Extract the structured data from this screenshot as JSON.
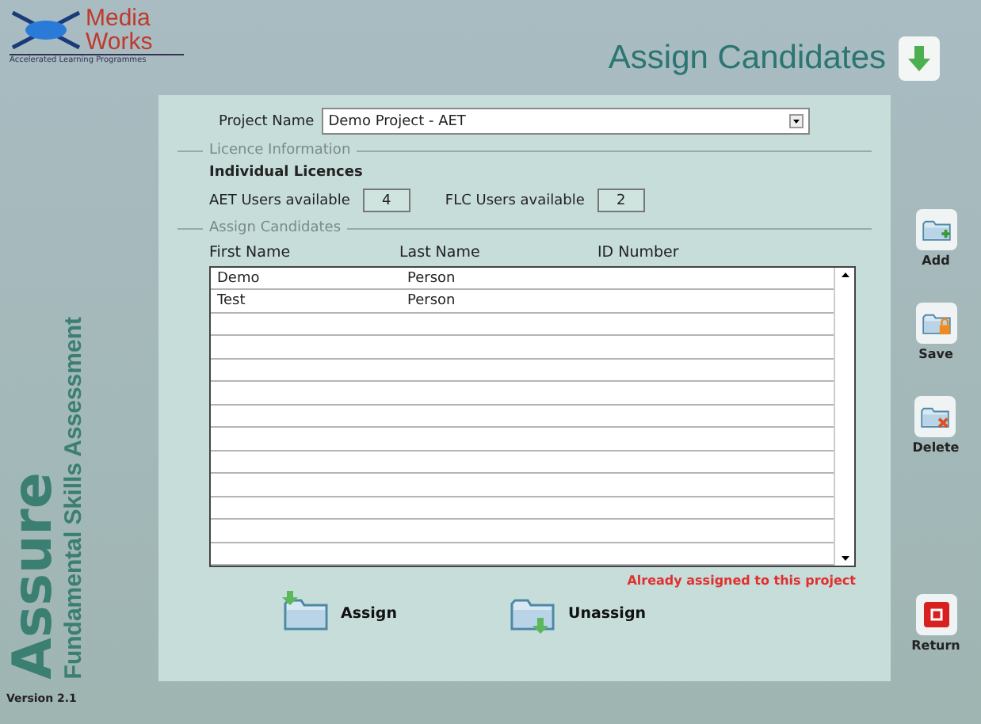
{
  "logo": {
    "line_1": "Media",
    "line_2": "Works",
    "tagline": "Accelerated Learning Programmes"
  },
  "title": "Assign Candidates",
  "sidebar": {
    "brand": "Assure",
    "subtitle": "Fundamental Skills Assessment",
    "version": "Version 2.1"
  },
  "project": {
    "label": "Project Name",
    "value": "Demo Project - AET"
  },
  "licence": {
    "legend": "Licence Information",
    "heading": "Individual Licences",
    "counters": [
      {
        "label": "AET Users available",
        "value": "4"
      },
      {
        "label": "FLC Users available",
        "value": "2"
      }
    ]
  },
  "candidates": {
    "legend": "Assign Candidates",
    "columns": [
      "First Name",
      "Last Name",
      "ID Number"
    ],
    "rows": [
      [
        "Demo",
        "Person"
      ],
      [
        "Test",
        "Person"
      ]
    ],
    "note": "Already assigned to this project"
  },
  "actions": [
    {
      "label": "Assign",
      "kind": "assign"
    },
    {
      "label": "Unassign",
      "kind": "unassign"
    }
  ],
  "toolbar": [
    {
      "label": "Add",
      "kind": "add"
    },
    {
      "label": "Save",
      "kind": "save"
    },
    {
      "label": "Delete",
      "kind": "delete"
    },
    {
      "label": "Return",
      "kind": "return"
    }
  ]
}
